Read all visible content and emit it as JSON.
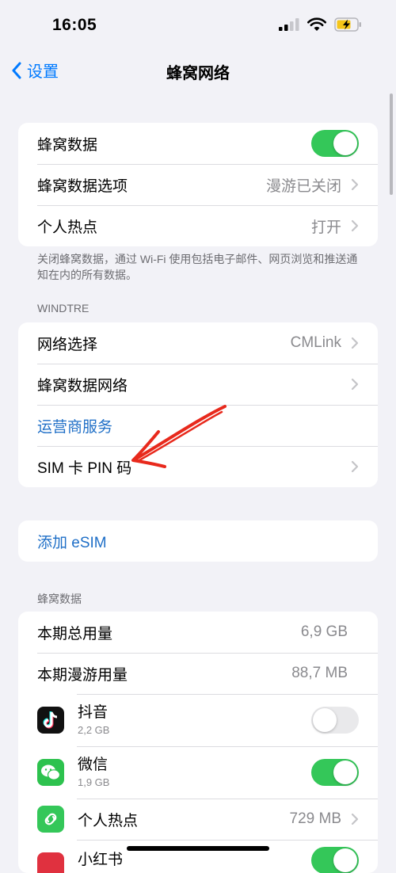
{
  "status_bar": {
    "time": "16:05"
  },
  "nav": {
    "back_label": "设置",
    "title": "蜂窝网络"
  },
  "cellular_group": {
    "cellular_data": {
      "label": "蜂窝数据",
      "toggle": "on"
    },
    "data_options": {
      "label": "蜂窝数据选项",
      "value": "漫游已关闭"
    },
    "hotspot": {
      "label": "个人热点",
      "value": "打开"
    }
  },
  "cellular_footer": "关闭蜂窝数据，通过 Wi-Fi 使用包括电子邮件、网页浏览和推送通知在内的所有数据。",
  "carrier": {
    "header": "WINDTRE",
    "network_selection": {
      "label": "网络选择",
      "value": "CMLink"
    },
    "cellular_data_network": {
      "label": "蜂窝数据网络"
    },
    "carrier_services": {
      "label": "运营商服务"
    },
    "sim_pin": {
      "label": "SIM 卡 PIN 码"
    }
  },
  "esim": {
    "label": "添加 eSIM"
  },
  "usage": {
    "header": "蜂窝数据",
    "current_period": {
      "label": "本期总用量",
      "value": "6,9 GB"
    },
    "current_roaming": {
      "label": "本期漫游用量",
      "value": "88,7 MB"
    },
    "apps": [
      {
        "name": "抖音",
        "size": "2,2 GB",
        "toggle": "off",
        "icon": "douyin-icon",
        "color": "#111111"
      },
      {
        "name": "微信",
        "size": "1,9 GB",
        "toggle": "on",
        "icon": "wechat-icon",
        "color": "#2dc24e"
      },
      {
        "name": "个人热点",
        "value": "729 MB",
        "icon": "hotspot-icon",
        "color": "#34c759"
      },
      {
        "name": "小红书",
        "toggle": "on",
        "icon": "xiaohongshu-icon",
        "color": "#e0313f"
      }
    ]
  },
  "colors": {
    "accent": "#007aff",
    "toggle_on": "#34c759",
    "annotation": "#e8291c"
  }
}
